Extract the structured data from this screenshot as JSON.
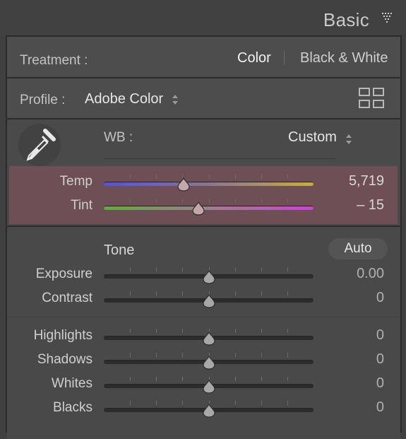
{
  "panel": {
    "title": "Basic"
  },
  "treatment": {
    "label": "Treatment :",
    "options": [
      "Color",
      "Black & White"
    ],
    "selected": "Color"
  },
  "profile": {
    "label": "Profile :",
    "value": "Adobe Color"
  },
  "wb": {
    "label": "WB :",
    "value": "Custom"
  },
  "temp": {
    "label": "Temp",
    "value": "5,719",
    "level": 0.38
  },
  "tint": {
    "label": "Tint",
    "value": "– 15",
    "level": 0.45
  },
  "tone": {
    "title": "Tone",
    "auto_label": "Auto",
    "exposure": {
      "label": "Exposure",
      "value": "0.00",
      "level": 0.5
    },
    "contrast": {
      "label": "Contrast",
      "value": "0",
      "level": 0.5
    },
    "highlights": {
      "label": "Highlights",
      "value": "0",
      "level": 0.5
    },
    "shadows": {
      "label": "Shadows",
      "value": "0",
      "level": 0.5
    },
    "whites": {
      "label": "Whites",
      "value": "0",
      "level": 0.5
    },
    "blacks": {
      "label": "Blacks",
      "value": "0",
      "level": 0.5
    }
  },
  "icons": {
    "collapse": "triangle-down-icon",
    "stepper": "up-down-stepper-icon",
    "profile_browser": "grid-icon",
    "eyedropper": "eyedropper-icon"
  },
  "colors": {
    "wb_highlight": "#6e4f55",
    "panel_bg": "#4a4a4a"
  }
}
